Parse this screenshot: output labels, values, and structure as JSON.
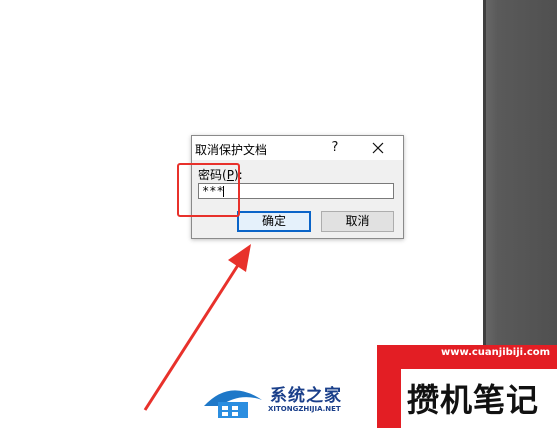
{
  "dialog": {
    "title": "取消保护文档",
    "help_label": "?",
    "field_label": "密码(",
    "field_label_accel": "P",
    "field_label_end": "):",
    "password_value": "***",
    "ok_label": "确定",
    "cancel_label": "取消"
  },
  "watermarks": {
    "logo1_title": "系统之家",
    "logo1_url": "XITONGZHIJIA.NET",
    "logo2_url": "www.cuanjibiji.com",
    "logo2_title": "攒机笔记"
  },
  "colors": {
    "highlight": "#e8312b",
    "dark_panel": "#5a5a5a",
    "ok_border": "#0a64c8"
  }
}
